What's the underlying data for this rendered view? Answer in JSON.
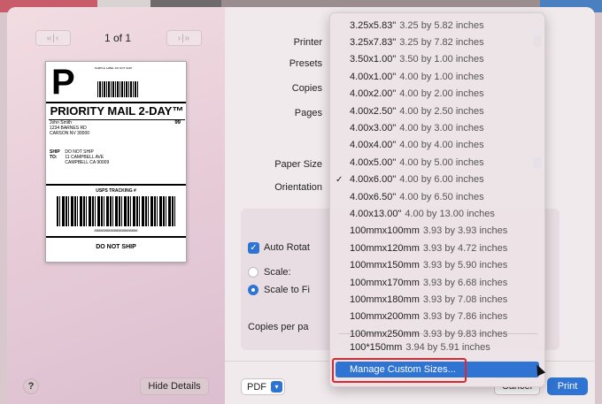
{
  "preview": {
    "page_label": "1 of 1",
    "prev_label": "«|‹",
    "next_label": "›|»",
    "label": {
      "big_letter": "P",
      "small_header": "SAMPLE LABEL\nDO NOT SHIP",
      "service": "PRIORITY MAIL 2-DAY™",
      "from_name": "John Smith",
      "from_street": "1234 BARNES RD",
      "from_city": "CARSON NV 30000",
      "from_num": "99",
      "ship_tag": "SHIP TO:",
      "ship_name": "DO NOT SHIP",
      "ship_street": "11 CAMPBELL AVE",
      "ship_city": "CAMPBELL CA 90009",
      "tracking_title": "USPS TRACKING #",
      "tracking_number": "8888888888888888888888",
      "do_not_ship": "DO NOT SHIP"
    }
  },
  "left_footer": {
    "help": "?",
    "hide_details": "Hide Details"
  },
  "options": {
    "printer": "Printer",
    "presets": "Presets",
    "copies": "Copies",
    "pages": "Pages",
    "paper_size": "Paper Size",
    "orientation": "Orientation",
    "auto_rotate": "Auto Rotat",
    "scale": "Scale:",
    "scale_to_fit": "Scale to Fi",
    "copies_per_page": "Copies per pa"
  },
  "paper_menu": {
    "items": [
      {
        "code": "3.25x5.83\"",
        "desc": "3.25 by 5.82 inches",
        "checked": false
      },
      {
        "code": "3.25x7.83\"",
        "desc": "3.25 by 7.82 inches",
        "checked": false
      },
      {
        "code": "3.50x1.00\"",
        "desc": "3.50 by 1.00 inches",
        "checked": false
      },
      {
        "code": "4.00x1.00\"",
        "desc": "4.00 by 1.00 inches",
        "checked": false
      },
      {
        "code": "4.00x2.00\"",
        "desc": "4.00 by 2.00 inches",
        "checked": false
      },
      {
        "code": "4.00x2.50\"",
        "desc": "4.00 by 2.50 inches",
        "checked": false
      },
      {
        "code": "4.00x3.00\"",
        "desc": "4.00 by 3.00 inches",
        "checked": false
      },
      {
        "code": "4.00x4.00\"",
        "desc": "4.00 by 4.00 inches",
        "checked": false
      },
      {
        "code": "4.00x5.00\"",
        "desc": "4.00 by 5.00 inches",
        "checked": false
      },
      {
        "code": "4.00x6.00\"",
        "desc": "4.00 by 6.00 inches",
        "checked": true
      },
      {
        "code": "4.00x6.50\"",
        "desc": "4.00 by 6.50 inches",
        "checked": false
      },
      {
        "code": "4.00x13.00\"",
        "desc": "4.00 by 13.00 inches",
        "checked": false
      },
      {
        "code": "100mmx100mm",
        "desc": "3.93 by 3.93 inches",
        "checked": false
      },
      {
        "code": "100mmx120mm",
        "desc": "3.93 by 4.72 inches",
        "checked": false
      },
      {
        "code": "100mmx150mm",
        "desc": "3.93 by 5.90 inches",
        "checked": false
      },
      {
        "code": "100mmx170mm",
        "desc": "3.93 by 6.68 inches",
        "checked": false
      },
      {
        "code": "100mmx180mm",
        "desc": "3.93 by 7.08 inches",
        "checked": false
      },
      {
        "code": "100mmx200mm",
        "desc": "3.93 by 7.86 inches",
        "checked": false
      },
      {
        "code": "100mmx250mm",
        "desc": "3.93 by 9.83 inches",
        "checked": false
      }
    ],
    "extra_item": {
      "code": "100*150mm",
      "desc": "3.94 by 5.91 inches"
    },
    "check_glyph": "✓",
    "manage": "Manage Custom Sizes..."
  },
  "footer": {
    "pdf": "PDF",
    "pdf_caret": "▾",
    "cancel": "Cancel",
    "print": "Print"
  }
}
